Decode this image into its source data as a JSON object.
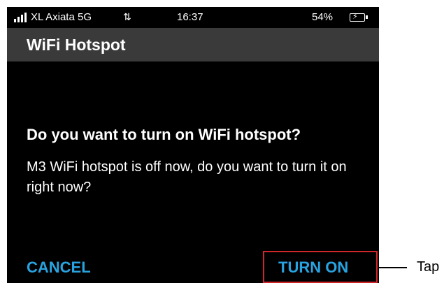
{
  "status_bar": {
    "carrier": "XL Axiata 5G",
    "data_arrows": "⇅",
    "time": "16:37",
    "battery_percent": "54%",
    "battery_icon": "battery-charging-icon",
    "signal_icon": "signal-bars-icon"
  },
  "header": {
    "title": "WiFi Hotspot",
    "background": "#3a3a3a"
  },
  "dialog": {
    "title": "Do you want to turn on WiFi hotspot?",
    "message": "M3 WiFi hotspot is off now, do you want to turn it on right now?",
    "cancel_label": "CANCEL",
    "confirm_label": "TURN ON",
    "button_color": "#29a3e0"
  },
  "annotation": {
    "label": "Tap",
    "highlight_color": "#d0262a"
  }
}
